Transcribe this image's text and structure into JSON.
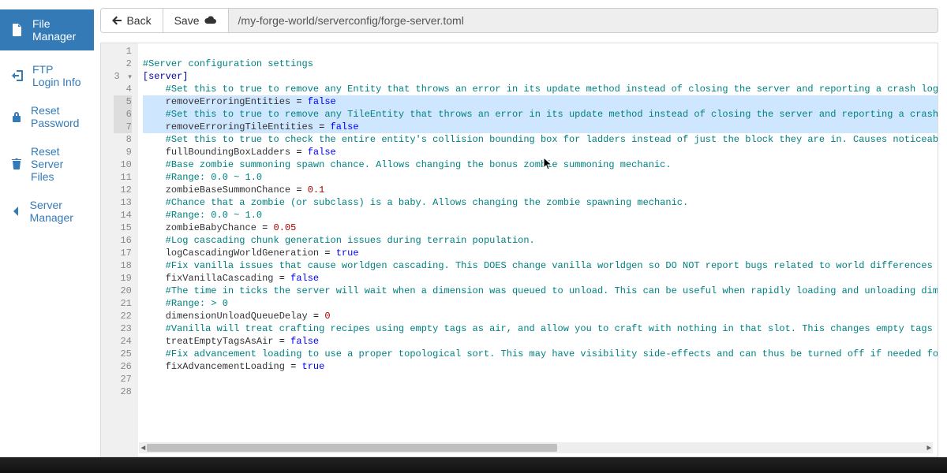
{
  "sidebar": {
    "items": [
      {
        "label": "File Manager",
        "icon": "file"
      },
      {
        "label": "FTP Login Info",
        "icon": "login"
      },
      {
        "label": "Reset Password",
        "icon": "lock"
      },
      {
        "label": "Reset Server Files",
        "icon": "trash"
      },
      {
        "label": "Server Manager",
        "icon": "chevron-left"
      }
    ]
  },
  "toolbar": {
    "back_label": "Back",
    "save_label": "Save",
    "path": "/my-forge-world/serverconfig/forge-server.toml"
  },
  "editor": {
    "highlighted_lines": [
      5,
      6,
      7
    ],
    "fold_line": 3,
    "last_line_number": 28,
    "lines": [
      {
        "n": 1,
        "t": "",
        "cls": ""
      },
      {
        "n": 2,
        "t": "#Server configuration settings",
        "cls": "comment"
      },
      {
        "n": 3,
        "t": "[server]",
        "cls": "section"
      },
      {
        "n": 4,
        "t": "    #Set this to true to remove any Entity that throws an error in its update method instead of closing the server and reporting a crash log.",
        "cls": "comment"
      },
      {
        "n": 5,
        "t": "    removeErroringEntities = false",
        "cls": "kv",
        "k": "removeErroringEntities",
        "v": "false",
        "vt": "bool"
      },
      {
        "n": 6,
        "t": "    #Set this to true to remove any TileEntity that throws an error in its update method instead of closing the server and reporting a crash",
        "cls": "comment"
      },
      {
        "n": 7,
        "t": "    removeErroringTileEntities = false",
        "cls": "kv",
        "k": "removeErroringTileEntities",
        "v": "false",
        "vt": "bool"
      },
      {
        "n": 8,
        "t": "    #Set this to true to check the entire entity's collision bounding box for ladders instead of just the block they are in. Causes noticeabl",
        "cls": "comment"
      },
      {
        "n": 9,
        "t": "    fullBoundingBoxLadders = false",
        "cls": "kv",
        "k": "fullBoundingBoxLadders",
        "v": "false",
        "vt": "bool"
      },
      {
        "n": 10,
        "t": "    #Base zombie summoning spawn chance. Allows changing the bonus zombie summoning mechanic.",
        "cls": "comment"
      },
      {
        "n": 11,
        "t": "    #Range: 0.0 ~ 1.0",
        "cls": "comment"
      },
      {
        "n": 12,
        "t": "    zombieBaseSummonChance = 0.1",
        "cls": "kv",
        "k": "zombieBaseSummonChance",
        "v": "0.1",
        "vt": "num"
      },
      {
        "n": 13,
        "t": "    #Chance that a zombie (or subclass) is a baby. Allows changing the zombie spawning mechanic.",
        "cls": "comment"
      },
      {
        "n": 14,
        "t": "    #Range: 0.0 ~ 1.0",
        "cls": "comment"
      },
      {
        "n": 15,
        "t": "    zombieBabyChance = 0.05",
        "cls": "kv",
        "k": "zombieBabyChance",
        "v": "0.05",
        "vt": "num"
      },
      {
        "n": 16,
        "t": "    #Log cascading chunk generation issues during terrain population.",
        "cls": "comment"
      },
      {
        "n": 17,
        "t": "    logCascadingWorldGeneration = true",
        "cls": "kv",
        "k": "logCascadingWorldGeneration",
        "v": "true",
        "vt": "bool"
      },
      {
        "n": 18,
        "t": "    #Fix vanilla issues that cause worldgen cascading. This DOES change vanilla worldgen so DO NOT report bugs related to world differences i",
        "cls": "comment"
      },
      {
        "n": 19,
        "t": "    fixVanillaCascading = false",
        "cls": "kv",
        "k": "fixVanillaCascading",
        "v": "false",
        "vt": "bool"
      },
      {
        "n": 20,
        "t": "    #The time in ticks the server will wait when a dimension was queued to unload. This can be useful when rapidly loading and unloading dime",
        "cls": "comment"
      },
      {
        "n": 21,
        "t": "    #Range: > 0",
        "cls": "comment"
      },
      {
        "n": 22,
        "t": "    dimensionUnloadQueueDelay = 0",
        "cls": "kv",
        "k": "dimensionUnloadQueueDelay",
        "v": "0",
        "vt": "num"
      },
      {
        "n": 23,
        "t": "    #Vanilla will treat crafting recipes using empty tags as air, and allow you to craft with nothing in that slot. This changes empty tags t",
        "cls": "comment"
      },
      {
        "n": 24,
        "t": "    treatEmptyTagsAsAir = false",
        "cls": "kv",
        "k": "treatEmptyTagsAsAir",
        "v": "false",
        "vt": "bool"
      },
      {
        "n": 25,
        "t": "    #Fix advancement loading to use a proper topological sort. This may have visibility side-effects and can thus be turned off if needed for",
        "cls": "comment"
      },
      {
        "n": 26,
        "t": "    fixAdvancementLoading = true",
        "cls": "kv",
        "k": "fixAdvancementLoading",
        "v": "true",
        "vt": "bool"
      },
      {
        "n": 27,
        "t": "",
        "cls": ""
      },
      {
        "n": 28,
        "t": "",
        "cls": ""
      }
    ]
  },
  "colors": {
    "accent": "#337ab7",
    "selection": "#cfe6ff",
    "comment": "#008080",
    "boolean": "#0000ff",
    "number": "#aa0000"
  }
}
